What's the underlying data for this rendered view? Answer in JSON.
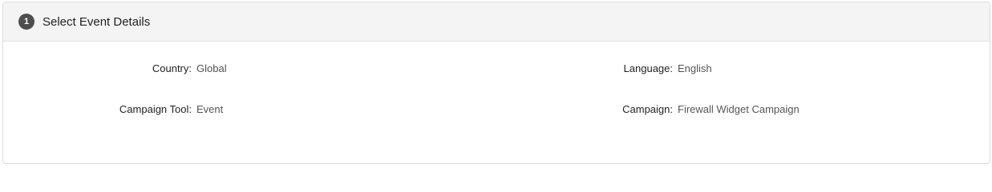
{
  "step": {
    "number": "1",
    "title": "Select Event Details"
  },
  "fields": {
    "country": {
      "label": "Country:",
      "value": "Global"
    },
    "language": {
      "label": "Language:",
      "value": "English"
    },
    "campaign_tool": {
      "label": "Campaign Tool:",
      "value": "Event"
    },
    "campaign": {
      "label": "Campaign:",
      "value": "Firewall Widget Campaign"
    }
  }
}
